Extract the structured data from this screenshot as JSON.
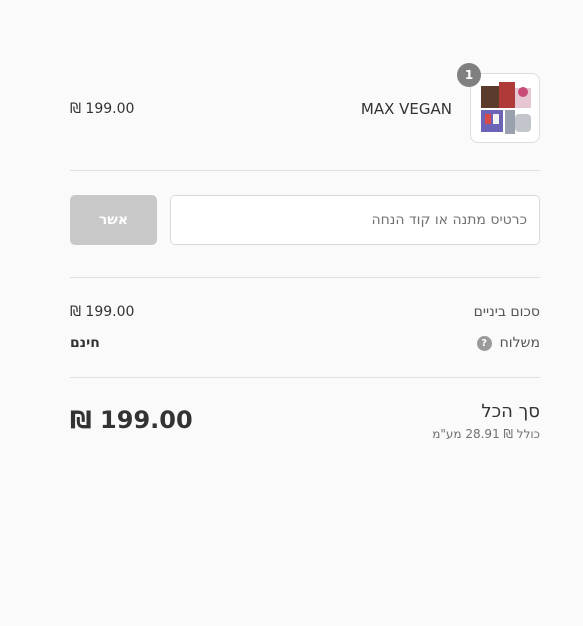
{
  "line_item": {
    "quantity": "1",
    "name": "MAX VEGAN",
    "price": "₪ 199.00"
  },
  "discount": {
    "placeholder": "כרטיס מתנה או קוד הנחה",
    "apply_label": "אשר"
  },
  "summary": {
    "subtotal_label": "סכום ביניים",
    "subtotal_value": "₪ 199.00",
    "shipping_label": "משלוח",
    "shipping_value": "חינם"
  },
  "total": {
    "label": "סך הכל",
    "tax_note": "כולל ₪ 28.91 מע\"מ",
    "value": "₪ 199.00"
  }
}
